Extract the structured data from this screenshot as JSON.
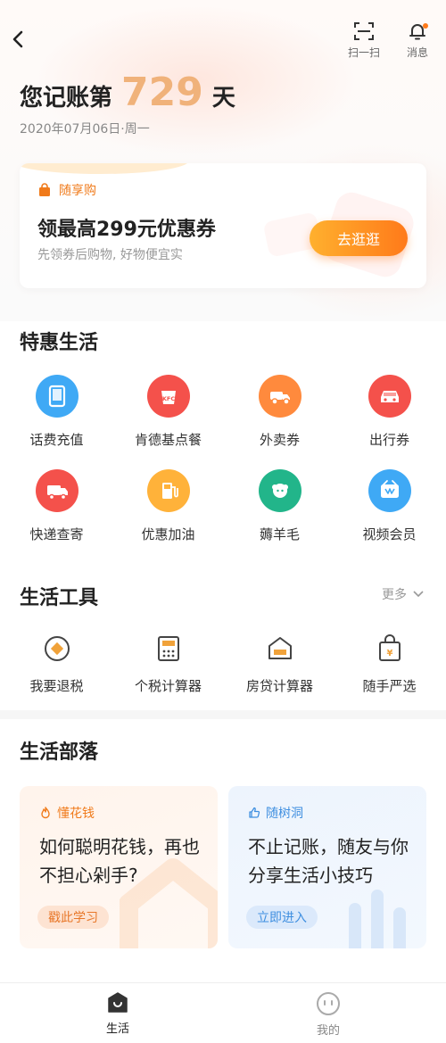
{
  "topbar": {
    "scan_label": "扫一扫",
    "message_label": "消息"
  },
  "header": {
    "days_prefix": "您记账第",
    "days_count": "729",
    "days_suffix": "天",
    "date_text": "2020年07月06日·周一"
  },
  "promo": {
    "tag": "随享购",
    "title": "领最高299元优惠券",
    "subtitle": "先领券后购物, 好物便宜实",
    "button_label": "去逛逛"
  },
  "discount_life": {
    "title": "特惠生活",
    "items": [
      {
        "label": "话费充值",
        "icon": "phone-recharge-icon",
        "color": "#3fa9f5"
      },
      {
        "label": "肯德基点餐",
        "icon": "kfc-icon",
        "color": "#f4514b"
      },
      {
        "label": "外卖券",
        "icon": "delivery-icon",
        "color": "#ff8a3d"
      },
      {
        "label": "出行券",
        "icon": "car-icon",
        "color": "#f4514b"
      },
      {
        "label": "快递查寄",
        "icon": "express-truck-icon",
        "color": "#f4514b"
      },
      {
        "label": "优惠加油",
        "icon": "fuel-icon",
        "color": "#ffb23a"
      },
      {
        "label": "薅羊毛",
        "icon": "sheep-icon",
        "color": "#22b58a"
      },
      {
        "label": "视频会员",
        "icon": "video-member-icon",
        "color": "#3fa9f5"
      }
    ]
  },
  "life_tools": {
    "title": "生活工具",
    "more_label": "更多",
    "items": [
      {
        "label": "我要退税",
        "icon": "tax-refund-icon"
      },
      {
        "label": "个税计算器",
        "icon": "tax-calculator-icon"
      },
      {
        "label": "房贷计算器",
        "icon": "mortgage-calculator-icon"
      },
      {
        "label": "随手严选",
        "icon": "shopping-bag-icon"
      }
    ]
  },
  "life_tribe": {
    "title": "生活部落",
    "cards": [
      {
        "tag": "懂花钱",
        "text": "如何聪明花钱，再也不担心剁手?",
        "button": "戳此学习"
      },
      {
        "tag": "随树洞",
        "text": "不止记账，随友与你分享生活小技巧",
        "button": "立即进入"
      }
    ]
  },
  "bottom_nav": {
    "items": [
      {
        "label": "生活",
        "active": true
      },
      {
        "label": "我的",
        "active": false
      }
    ]
  },
  "colors": {
    "accent": "#ff7a1a",
    "days_number": "#f0b27a",
    "tribe_orange": "#f07a1a",
    "tribe_blue": "#3f8fe0"
  }
}
